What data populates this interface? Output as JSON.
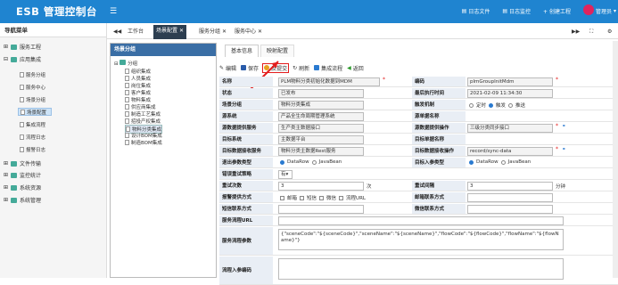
{
  "header": {
    "brand": "ESB 管理控制台",
    "links": [
      "日志文件",
      "日志监控",
      "+ 创建工程"
    ],
    "user": "管理员"
  },
  "sidebar": {
    "title": "导航菜单",
    "groups": [
      "服务工程",
      "应用集成"
    ],
    "children": [
      "服务分组",
      "服务中心",
      "场景分组",
      "场景配置",
      "集成流程",
      "流程日志",
      "报警日志"
    ],
    "bottom": [
      "文件传输",
      "监控统计",
      "系统资源",
      "系统管理"
    ]
  },
  "tabs": [
    "工作台",
    "场景配置",
    "服务分组",
    "服务中心"
  ],
  "tree": {
    "title": "场景分组",
    "root": "分组",
    "nodes": [
      "组织集成",
      "人员集成",
      "岗位集成",
      "客户集成",
      "物料集成",
      "供应商集成",
      "制造工艺集成",
      "招投产权集成",
      "物料分类集成",
      "设计BOM集成",
      "制造BOM集成"
    ]
  },
  "subtabs": [
    "基本信息",
    "映射配置"
  ],
  "toolbar": [
    "编辑",
    "保存",
    "反提交",
    "刷新",
    "集成流程",
    "返回"
  ],
  "form": {
    "name_label": "名称",
    "name": "PLM物料分类初始化数据到MDM",
    "code_label": "编码",
    "code": "plmGroupInitMdm",
    "status_label": "状态",
    "status": "已发布",
    "last_exec_label": "最后执行时间",
    "last_exec": "2021-02-09 11:34:30",
    "scene_group_label": "场景分组",
    "scene_group": "物料分类集成",
    "trigger_label": "触发机制",
    "trigger_options": [
      "定时",
      "触发",
      "推送"
    ],
    "source_label": "源系统",
    "source": "产品全生命周期管理系统",
    "src_name_label": "源单据名称",
    "src_name": "",
    "src_service_label": "源数据提供服务",
    "src_service": "生产类主数据接口",
    "src_op_label": "源数据提供操作",
    "src_op": "三级分类同步接口",
    "target_label": "目标系统",
    "target": "主数据平台",
    "tgt_name_label": "目标单据名称",
    "tgt_name": "",
    "tgt_service_label": "目标数据接收服务",
    "tgt_service": "物料分类主数据Rest服务",
    "tgt_op_label": "目标数据接收操作",
    "tgt_op": "record/sync-data",
    "out_type_label": "退出参数类型",
    "out_type_options": [
      "DataRow",
      "JavaBean"
    ],
    "in_type_label": "目标入参类型",
    "in_type_options": [
      "DataRow",
      "JavaBean"
    ],
    "retry_label": "错误重试策略",
    "retry": "有",
    "retry_count_label": "重试次数",
    "retry_count": "3",
    "retry_count_unit": "次",
    "retry_interval_label": "重试间隔",
    "retry_interval": "3",
    "retry_interval_unit": "分钟",
    "alarm_label": "报警提供方式",
    "alarm_options": [
      "邮箱",
      "短信",
      "微信",
      "流程URL"
    ],
    "mail_label": "邮箱联系方式",
    "mail": "",
    "sms_label": "短信联系方式",
    "sms": "",
    "wechat_label": "微信联系方式",
    "wechat": "",
    "flow_url_label": "服务流程URL",
    "flow_url": "",
    "flow_params_label": "服务流程参数",
    "flow_params": "{\"sceneCode\":\"${sceneCode}\",\"sceneName\":\"${sceneName}\",\"flowCode\":\"${flowCode}\",\"flowName\":\"${flowName}\"}",
    "flow_input_label": "流程入参编码"
  },
  "colors": {
    "accent": "#1f84d0",
    "alert": "#e31c1c"
  }
}
